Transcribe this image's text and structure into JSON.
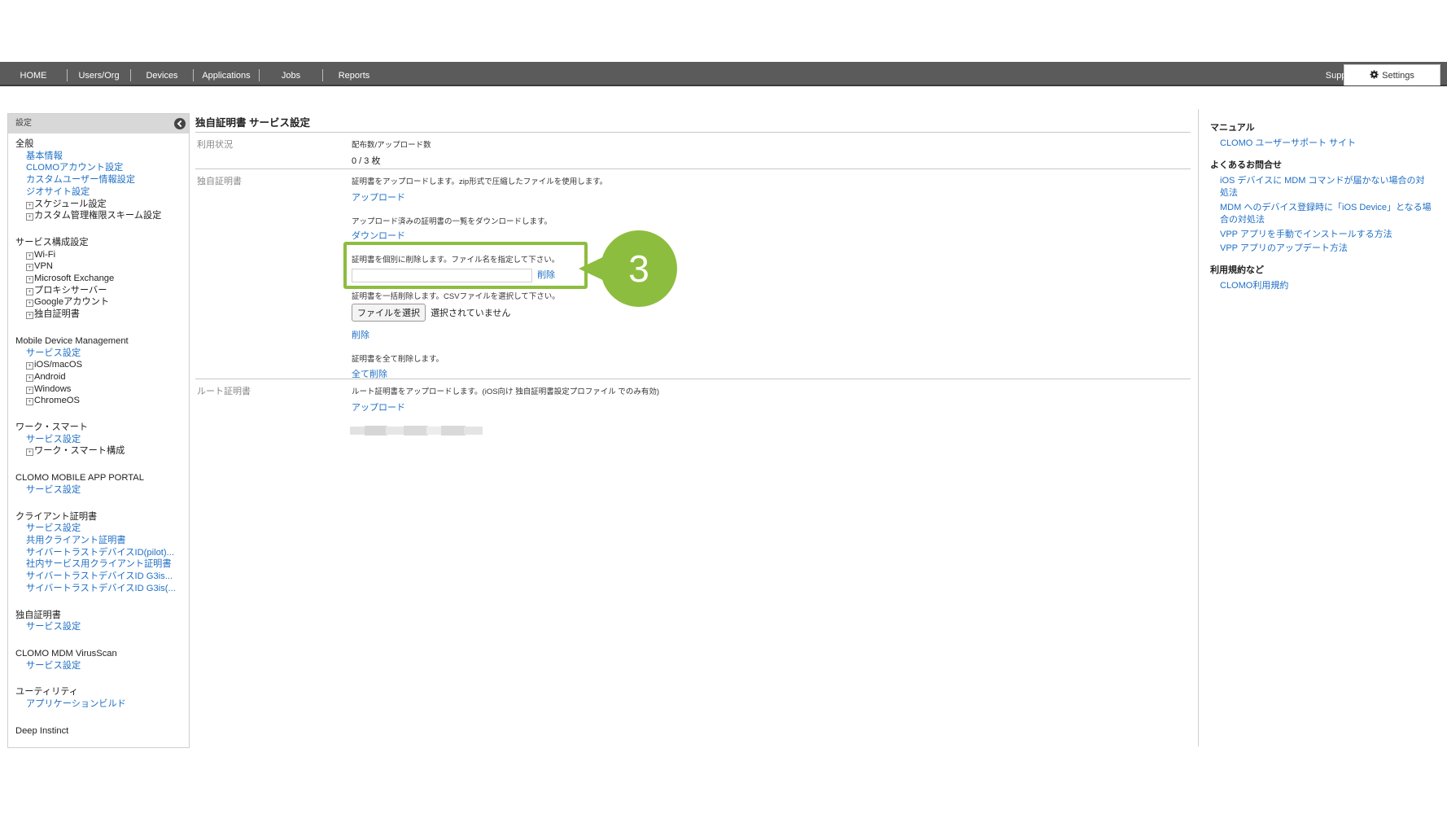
{
  "nav": {
    "tabs": [
      "HOME",
      "Users/Org",
      "Devices",
      "Applications",
      "Jobs",
      "Reports"
    ],
    "support": "Support",
    "settings": "Settings"
  },
  "sidebar": {
    "header": "設定",
    "groups": [
      {
        "title": "全般",
        "items": [
          {
            "label": "基本情報",
            "type": "link"
          },
          {
            "label": "CLOMOアカウント設定",
            "type": "link"
          },
          {
            "label": "カスタムユーザー情報設定",
            "type": "link"
          },
          {
            "label": "ジオサイト設定",
            "type": "link"
          },
          {
            "label": "スケジュール設定",
            "type": "expand"
          },
          {
            "label": "カスタム管理権限スキーム設定",
            "type": "expand"
          }
        ]
      },
      {
        "title": "サービス構成設定",
        "items": [
          {
            "label": "Wi-Fi",
            "type": "expand"
          },
          {
            "label": "VPN",
            "type": "expand"
          },
          {
            "label": "Microsoft Exchange",
            "type": "expand"
          },
          {
            "label": "プロキシサーバー",
            "type": "expand"
          },
          {
            "label": "Googleアカウント",
            "type": "expand"
          },
          {
            "label": "独自証明書",
            "type": "expand"
          }
        ]
      },
      {
        "title": "Mobile Device Management",
        "items": [
          {
            "label": "サービス設定",
            "type": "link"
          },
          {
            "label": "iOS/macOS",
            "type": "expand"
          },
          {
            "label": "Android",
            "type": "expand"
          },
          {
            "label": "Windows",
            "type": "expand"
          },
          {
            "label": "ChromeOS",
            "type": "expand"
          }
        ]
      },
      {
        "title": "ワーク・スマート",
        "items": [
          {
            "label": "サービス設定",
            "type": "link"
          },
          {
            "label": "ワーク・スマート構成",
            "type": "expand"
          }
        ]
      },
      {
        "title": "CLOMO MOBILE APP PORTAL",
        "items": [
          {
            "label": "サービス設定",
            "type": "link"
          }
        ]
      },
      {
        "title": "クライアント証明書",
        "items": [
          {
            "label": "サービス設定",
            "type": "link"
          },
          {
            "label": "共用クライアント証明書",
            "type": "link"
          },
          {
            "label": "サイバートラストデバイスID(pilot)...",
            "type": "link"
          },
          {
            "label": "社内サービス用クライアント証明書",
            "type": "link"
          },
          {
            "label": "サイバートラストデバイスID G3is...",
            "type": "link"
          },
          {
            "label": "サイバートラストデバイスID G3is(...",
            "type": "link"
          }
        ]
      },
      {
        "title": "独自証明書",
        "items": [
          {
            "label": "サービス設定",
            "type": "link"
          }
        ]
      },
      {
        "title": "CLOMO MDM VirusScan",
        "items": [
          {
            "label": "サービス設定",
            "type": "link"
          }
        ]
      },
      {
        "title": "ユーティリティ",
        "items": [
          {
            "label": "アプリケーションビルド",
            "type": "link"
          }
        ]
      },
      {
        "title": "Deep Instinct",
        "items": []
      }
    ]
  },
  "main": {
    "title": "独自証明書 サービス設定",
    "usage": {
      "label": "利用状況",
      "caption": "配布数/アップロード数",
      "value": "0 / 3 枚"
    },
    "cert": {
      "label": "独自証明書",
      "upload_desc": "証明書をアップロードします。zip形式で圧縮したファイルを使用します。",
      "upload_link": "アップロード",
      "download_desc": "アップロード済みの証明書の一覧をダウンロードします。",
      "download_link": "ダウンロード",
      "single_delete_desc": "証明書を個別に削除します。ファイル名を指定して下さい。",
      "single_delete_link": "削除",
      "bulk_delete_desc": "証明書を一括削除します。CSVファイルを選択して下さい。",
      "choose_file": "ファイルを選択",
      "no_file": "選択されていません",
      "bulk_delete_link": "削除",
      "all_delete_desc": "証明書を全て削除します。",
      "all_delete_link": "全て削除"
    },
    "root": {
      "label": "ルート証明書",
      "desc": "ルート証明書をアップロードします。(iOS向け 独自証明書設定プロファイル でのみ有効)",
      "upload_link": "アップロード"
    },
    "callout_number": "3"
  },
  "right": {
    "manual_head": "マニュアル",
    "manual_link": "CLOMO ユーザーサポート サイト",
    "faq_head": "よくあるお問合せ",
    "faq_links": [
      "iOS デバイスに MDM コマンドが届かない場合の対処法",
      "MDM へのデバイス登録時に「iOS Device」となる場合の対処法",
      "VPP アプリを手動でインストールする方法",
      "VPP アプリのアップデート方法"
    ],
    "terms_head": "利用規約など",
    "terms_link": "CLOMO利用規約"
  },
  "colors": {
    "nav_bg": "#5b5b5b",
    "link": "#1f6fc5",
    "highlight": "#8dbd3e"
  }
}
